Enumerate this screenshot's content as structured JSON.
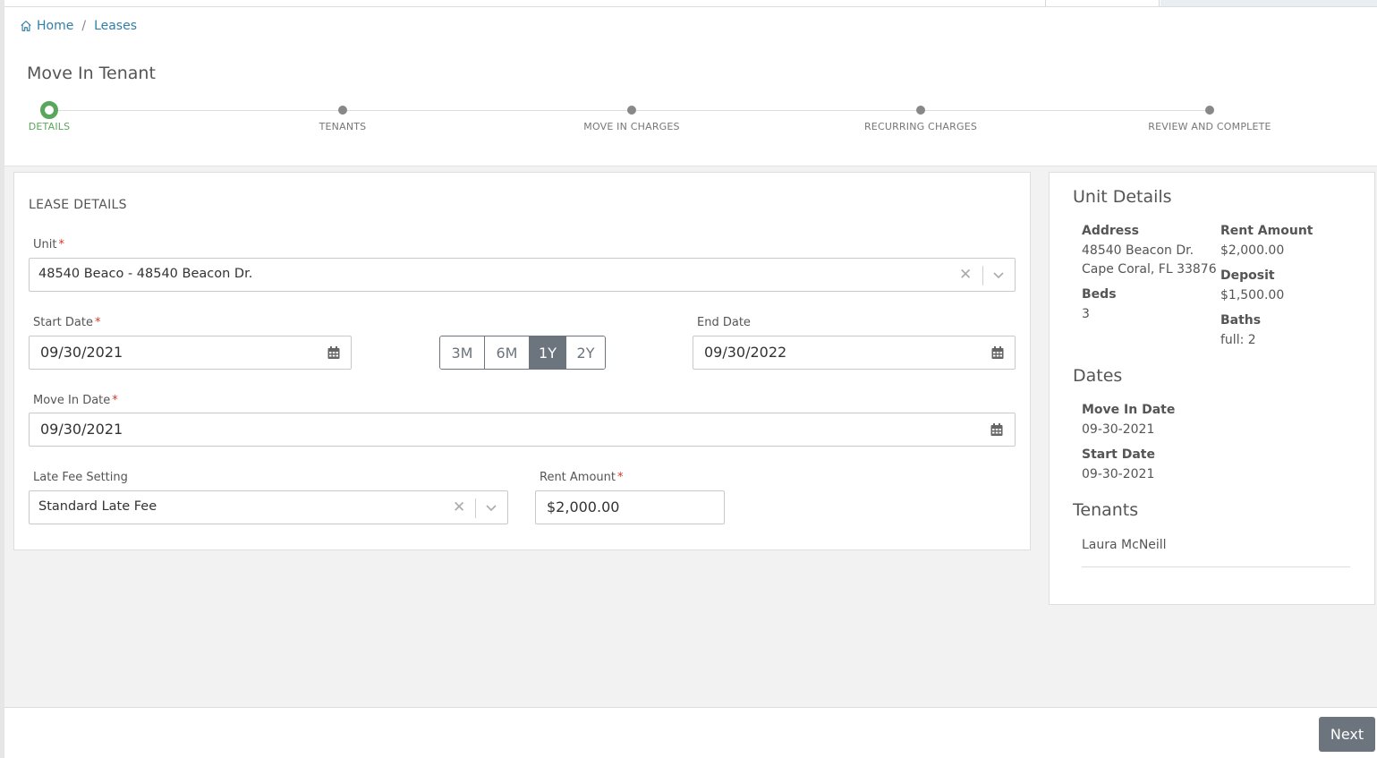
{
  "breadcrumb": {
    "home": "Home",
    "separator": "/",
    "current": "Leases"
  },
  "page": {
    "title": "Move In Tenant"
  },
  "stepper": {
    "active_color": "#5aa75c",
    "steps": [
      {
        "label": "DETAILS",
        "active": true
      },
      {
        "label": "TENANTS",
        "active": false
      },
      {
        "label": "MOVE IN CHARGES",
        "active": false
      },
      {
        "label": "RECURRING CHARGES",
        "active": false
      },
      {
        "label": "REVIEW AND COMPLETE",
        "active": false
      }
    ]
  },
  "lease": {
    "section_title": "LEASE DETAILS",
    "unit": {
      "label": "Unit",
      "required": "*",
      "value": "48540 Beaco - 48540 Beacon Dr."
    },
    "start_date": {
      "label": "Start Date",
      "required": "*",
      "value": "09/30/2021"
    },
    "term_buttons": [
      {
        "label": "3M",
        "active": false
      },
      {
        "label": "6M",
        "active": false
      },
      {
        "label": "1Y",
        "active": true
      },
      {
        "label": "2Y",
        "active": false
      }
    ],
    "end_date": {
      "label": "End Date",
      "value": "09/30/2022"
    },
    "move_in_date": {
      "label": "Move In Date",
      "required": "*",
      "value": "09/30/2021"
    },
    "late_fee": {
      "label": "Late Fee Setting",
      "value": "Standard Late Fee"
    },
    "rent_amount": {
      "label": "Rent Amount",
      "required": "*",
      "value": "$2,000.00"
    }
  },
  "unit_details": {
    "title": "Unit Details",
    "address_label": "Address",
    "address_line1": "48540 Beacon Dr.",
    "address_line2": "Cape Coral, FL 33876",
    "rent_label": "Rent Amount",
    "rent_value": "$2,000.00",
    "deposit_label": "Deposit",
    "deposit_value": "$1,500.00",
    "beds_label": "Beds",
    "beds_value": "3",
    "baths_label": "Baths",
    "baths_value": "full: 2"
  },
  "dates": {
    "title": "Dates",
    "move_in_label": "Move In Date",
    "move_in_value": "09-30-2021",
    "start_label": "Start Date",
    "start_value": "09-30-2021"
  },
  "tenants": {
    "title": "Tenants",
    "names": [
      "Laura McNeill"
    ]
  },
  "footer": {
    "next_label": "Next"
  },
  "icons": {
    "home": "home-icon",
    "calendar": "calendar-icon",
    "clear": "clear-icon",
    "chevron": "chevron-down-icon"
  },
  "colors": {
    "link": "#2f7fa6",
    "button": "#6c757d",
    "required": "#d9342b"
  }
}
